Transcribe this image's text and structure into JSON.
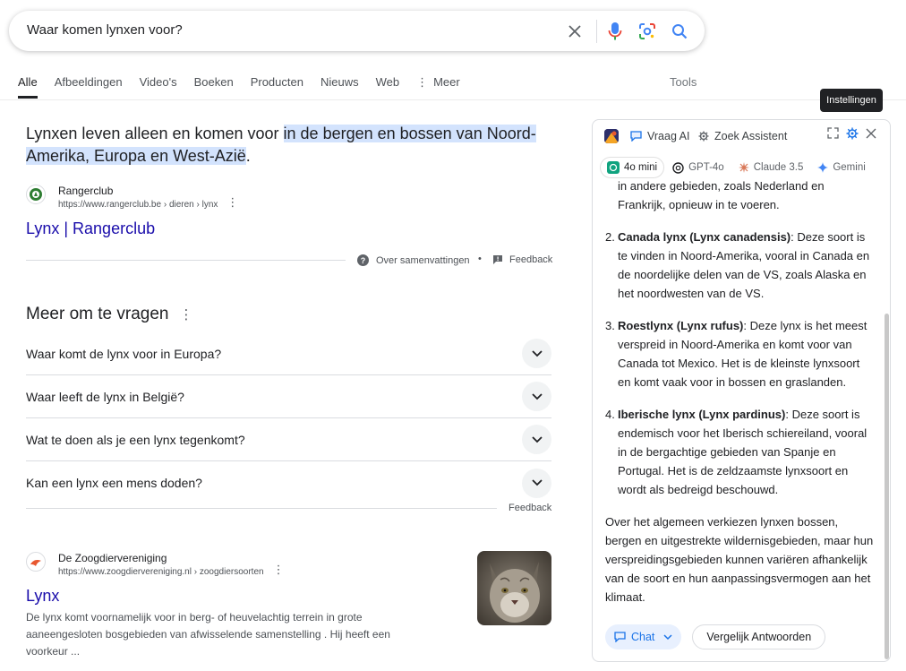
{
  "search": {
    "query": "Waar komen lynxen voor?"
  },
  "tabs": [
    "Alle",
    "Afbeeldingen",
    "Video's",
    "Boeken",
    "Producten",
    "Nieuws",
    "Web",
    "Meer"
  ],
  "tools_label": "Tools",
  "tooltip": "Instellingen",
  "answer": {
    "prefix": "Lynxen leven alleen en komen voor ",
    "highlight": "in de bergen en bossen van Noord-Amerika, Europa en West-Azië",
    "suffix": "."
  },
  "source1": {
    "name": "Rangerclub",
    "url": "https://www.rangerclub.be › dieren › lynx",
    "title": "Lynx | Rangerclub"
  },
  "meta": {
    "about": "Over samenvattingen",
    "feedback": "Feedback",
    "feedback2": "Feedback"
  },
  "paa": {
    "title": "Meer om te vragen",
    "questions": [
      "Waar komt de lynx voor in Europa?",
      "Waar leeft de lynx in België?",
      "Wat te doen als je een lynx tegenkomt?",
      "Kan een lynx een mens doden?"
    ]
  },
  "source2": {
    "name": "De Zoogdiervereniging",
    "url": "https://www.zoogdiervereniging.nl › zoogdiersoorten",
    "title": "Lynx",
    "snippet": "De lynx komt voornamelijk voor in berg- of heuvelachtig terrein in grote aaneengesloten bosgebieden van afwisselende samenstelling . Hij heeft een voorkeur ..."
  },
  "ai": {
    "tab_ask": "Vraag AI",
    "tab_assist": "Zoek Assistent",
    "models": [
      "4o mini",
      "GPT-4o",
      "Claude 3.5",
      "Gemini"
    ],
    "intro": "in andere gebieden, zoals Nederland en Frankrijk, opnieuw in te voeren.",
    "items": [
      {
        "num": "2.",
        "bold": "Canada lynx (Lynx canadensis)",
        "text": ": Deze soort is te vinden in Noord-Amerika, vooral in Canada en de noordelijke delen van de VS, zoals Alaska en het noordwesten van de VS."
      },
      {
        "num": "3.",
        "bold": "Roestlynx (Lynx rufus)",
        "text": ": Deze lynx is het meest verspreid in Noord-Amerika en komt voor van Canada tot Mexico. Het is de kleinste lynxsoort en komt vaak voor in bossen en graslanden."
      },
      {
        "num": "4.",
        "bold": "Iberische lynx (Lynx pardinus)",
        "text": ": Deze soort is endemisch voor het Iberisch schiereiland, vooral in de bergachtige gebieden van Spanje en Portugal. Het is de zeldzaamste lynxsoort en wordt als bedreigd beschouwd."
      }
    ],
    "conclusion": "Over het algemeen verkiezen lynxen bossen, bergen en uitgestrekte wildernisgebieden, maar hun verspreidingsgebieden kunnen variëren afhankelijk van de soort en hun aanpassingsvermogen aan het klimaat.",
    "chat_label": "Chat",
    "compare_label": "Vergelijk Antwoorden"
  },
  "colors": {
    "link": "#1a0dab",
    "highlight": "#d3e3fd",
    "accent": "#1a73e8"
  }
}
